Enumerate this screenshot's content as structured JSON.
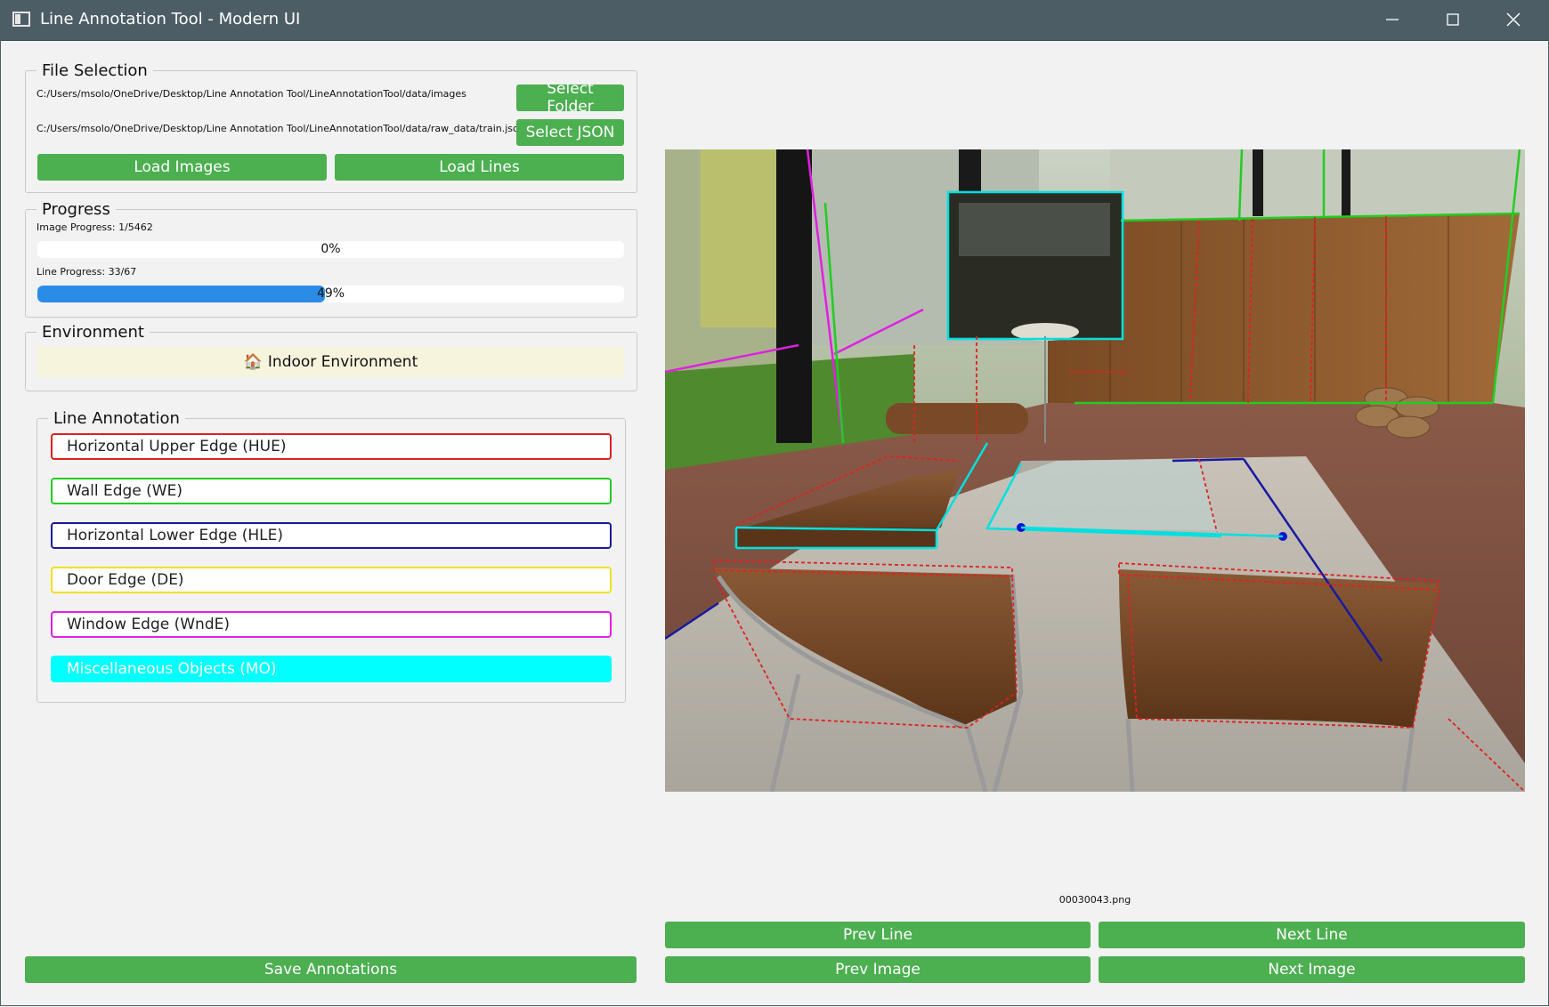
{
  "window": {
    "title": "Line Annotation Tool - Modern UI"
  },
  "file_selection": {
    "legend": "File Selection",
    "images_path": "C:/Users/msolo/OneDrive/Desktop/Line Annotation Tool/LineAnnotationTool/data/images",
    "json_path": "C:/Users/msolo/OneDrive/Desktop/Line Annotation Tool/LineAnnotationTool/data/raw_data/train.json",
    "select_folder": "Select Folder",
    "select_json": "Select JSON",
    "load_images": "Load Images",
    "load_lines": "Load Lines"
  },
  "progress": {
    "legend": "Progress",
    "image_label": "Image Progress: 1/5462",
    "image_percent_text": "0%",
    "image_fraction": 0.0,
    "line_label": "Line Progress: 33/67",
    "line_percent_text": "49%",
    "line_fraction": 0.49
  },
  "environment": {
    "legend": "Environment",
    "icon": "house-icon",
    "icon_glyph": "🏠",
    "value": "Indoor Environment"
  },
  "line_annotation": {
    "legend": "Line Annotation",
    "items": [
      {
        "label": "Horizontal Upper Edge (HUE)",
        "color": "#e02020",
        "selected": false
      },
      {
        "label": "Wall Edge (WE)",
        "color": "#22cc22",
        "selected": false
      },
      {
        "label": "Horizontal Lower Edge (HLE)",
        "color": "#1a1aa0",
        "selected": false
      },
      {
        "label": "Door Edge (DE)",
        "color": "#f0e020",
        "selected": false
      },
      {
        "label": "Window Edge (WndE)",
        "color": "#e020e0",
        "selected": false
      },
      {
        "label": "Miscellaneous Objects (MO)",
        "color": "#00ffff",
        "selected": true
      }
    ]
  },
  "actions": {
    "save": "Save Annotations",
    "prev_line": "Prev Line",
    "next_line": "Next Line",
    "prev_image": "Prev Image",
    "next_image": "Next Image"
  },
  "image_view": {
    "filename": "00030043.png"
  },
  "colors": {
    "accent": "#4caf50",
    "progress": "#2b8ce8",
    "titlebar": "#4d5d66"
  }
}
